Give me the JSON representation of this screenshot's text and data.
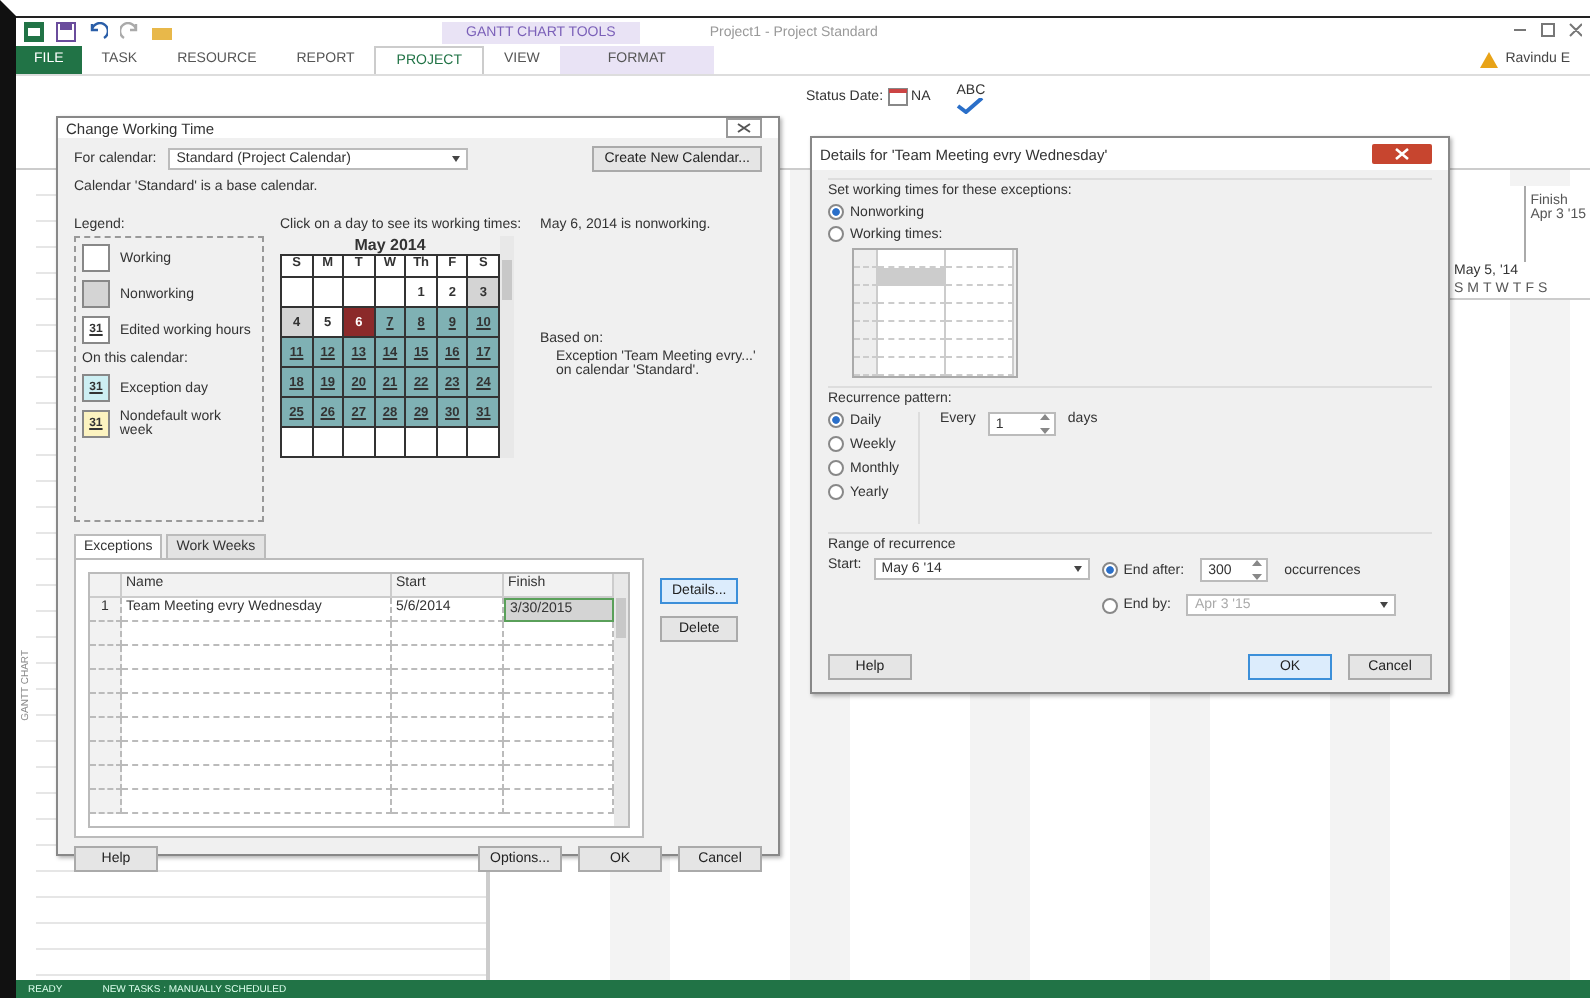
{
  "app": {
    "title": "Project1 - Project Standard",
    "context_tab": "GANTT CHART TOOLS",
    "user": "Ravindu E",
    "tabs": [
      {
        "label": "FILE",
        "kind": "file",
        "selected": false
      },
      {
        "label": "TASK",
        "kind": "tab",
        "selected": false
      },
      {
        "label": "RESOURCE",
        "kind": "tab",
        "selected": false
      },
      {
        "label": "REPORT",
        "kind": "tab",
        "selected": false
      },
      {
        "label": "PROJECT",
        "kind": "tab",
        "selected": true
      },
      {
        "label": "VIEW",
        "kind": "tab",
        "selected": false
      },
      {
        "label": "FORMAT",
        "kind": "context",
        "selected": false
      }
    ],
    "status_date_label": "Status Date:",
    "status_date_value": "NA",
    "spelling_label": "ABC",
    "side_label": "GANTT CHART",
    "timeline": {
      "finish_label": "Finish",
      "finish_date": "Apr 3 '15",
      "week_label": "May 5, '14",
      "days": [
        "S",
        "M",
        "T",
        "W",
        "T",
        "F",
        "S"
      ]
    },
    "status_bar": [
      "READY",
      "NEW TASKS : MANUALLY SCHEDULED"
    ]
  },
  "change_working_time": {
    "title": "Change Working Time",
    "for_calendar_label": "For calendar:",
    "calendar_value": "Standard (Project Calendar)",
    "create_button": "Create New Calendar...",
    "base_note": "Calendar 'Standard' is a base calendar.",
    "legend_title": "Legend:",
    "legend": [
      {
        "label": "Working",
        "kind": "working"
      },
      {
        "label": "Nonworking",
        "kind": "nonworking"
      },
      {
        "label": "Edited working hours",
        "kind": "edited",
        "mark": "31"
      },
      {
        "label": "On this calendar:",
        "kind": "heading"
      },
      {
        "label": "Exception day",
        "kind": "exception",
        "mark": "31"
      },
      {
        "label": "Nondefault work week",
        "kind": "nondefault",
        "mark": "31"
      }
    ],
    "calendar_prompt": "Click on a day to see its working times:",
    "month": "May 2014",
    "weekdays": [
      "S",
      "M",
      "T",
      "W",
      "Th",
      "F",
      "S"
    ],
    "weeks": [
      [
        {
          "kind": "blank"
        },
        {
          "kind": "blank"
        },
        {
          "kind": "blank"
        },
        {
          "kind": "blank"
        },
        {
          "day": "1",
          "kind": "working"
        },
        {
          "day": "2",
          "kind": "working"
        },
        {
          "day": "3",
          "kind": "nonworking"
        }
      ],
      [
        {
          "day": "4",
          "kind": "nonworking"
        },
        {
          "day": "5",
          "kind": "working"
        },
        {
          "day": "6",
          "kind": "selected"
        },
        {
          "day": "7",
          "kind": "exception"
        },
        {
          "day": "8",
          "kind": "exception"
        },
        {
          "day": "9",
          "kind": "exception"
        },
        {
          "day": "10",
          "kind": "exception"
        }
      ],
      [
        {
          "day": "11",
          "kind": "exception"
        },
        {
          "day": "12",
          "kind": "exception"
        },
        {
          "day": "13",
          "kind": "exception"
        },
        {
          "day": "14",
          "kind": "exception"
        },
        {
          "day": "15",
          "kind": "exception"
        },
        {
          "day": "16",
          "kind": "exception"
        },
        {
          "day": "17",
          "kind": "exception"
        }
      ],
      [
        {
          "day": "18",
          "kind": "exception"
        },
        {
          "day": "19",
          "kind": "exception"
        },
        {
          "day": "20",
          "kind": "exception"
        },
        {
          "day": "21",
          "kind": "exception"
        },
        {
          "day": "22",
          "kind": "exception"
        },
        {
          "day": "23",
          "kind": "exception"
        },
        {
          "day": "24",
          "kind": "exception"
        }
      ],
      [
        {
          "day": "25",
          "kind": "exception"
        },
        {
          "day": "26",
          "kind": "exception"
        },
        {
          "day": "27",
          "kind": "exception"
        },
        {
          "day": "28",
          "kind": "exception"
        },
        {
          "day": "29",
          "kind": "exception"
        },
        {
          "day": "30",
          "kind": "exception"
        },
        {
          "day": "31",
          "kind": "exception"
        }
      ],
      [
        {
          "kind": "blank"
        },
        {
          "kind": "blank"
        },
        {
          "kind": "blank"
        },
        {
          "kind": "blank"
        },
        {
          "kind": "blank"
        },
        {
          "kind": "blank"
        },
        {
          "kind": "blank"
        }
      ]
    ],
    "day_status": "May 6, 2014 is nonworking.",
    "based_on_label": "Based on:",
    "based_on_text": "Exception 'Team Meeting evry...' on calendar 'Standard'.",
    "tabs": [
      {
        "label": "Exceptions",
        "selected": true
      },
      {
        "label": "Work Weeks",
        "selected": false
      }
    ],
    "columns": [
      "Name",
      "Start",
      "Finish"
    ],
    "rows": [
      {
        "id": "1",
        "name": "Team Meeting evry Wednesday",
        "start": "5/6/2014",
        "finish": "3/30/2015"
      }
    ],
    "side_buttons": [
      {
        "label": "Details...",
        "focused": true
      },
      {
        "label": "Delete",
        "focused": false
      }
    ],
    "help_button": "Help",
    "buttons": [
      "Options...",
      "OK",
      "Cancel"
    ]
  },
  "details": {
    "title": "Details for 'Team Meeting evry Wednesday'",
    "working_group": "Set working times for these exceptions:",
    "working_options": [
      {
        "label": "Nonworking",
        "selected": true
      },
      {
        "label": "Working times:",
        "selected": false
      }
    ],
    "recurrence_title": "Recurrence pattern:",
    "patterns": [
      {
        "label": "Daily",
        "selected": true
      },
      {
        "label": "Weekly",
        "selected": false
      },
      {
        "label": "Monthly",
        "selected": false
      },
      {
        "label": "Yearly",
        "selected": false
      }
    ],
    "every_label": "Every",
    "every_value": "1",
    "every_unit": "days",
    "range_title": "Range of recurrence",
    "start_label": "Start:",
    "start_value": "May 6 '14",
    "end_options": [
      {
        "label": "End after:",
        "selected": true
      },
      {
        "label": "End by:",
        "selected": false
      }
    ],
    "occurrences_value": "300",
    "occurrences_label": "occurrences",
    "end_by_value": "Apr 3 '15",
    "help_button": "Help",
    "buttons": [
      "OK",
      "Cancel"
    ]
  }
}
